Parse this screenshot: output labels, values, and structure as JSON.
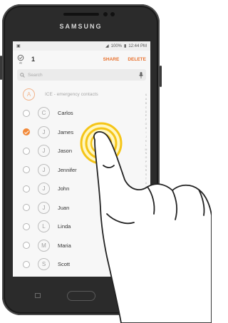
{
  "device": {
    "brand": "SAMSUNG"
  },
  "status_bar": {
    "battery": "100%",
    "time": "12:44 PM"
  },
  "action_bar": {
    "selected_count": "1",
    "share_label": "SHARE",
    "delete_label": "DELETE"
  },
  "search": {
    "placeholder": "Search"
  },
  "ice": {
    "letter": "A",
    "label": "ICE - emergency contacts"
  },
  "contacts": [
    {
      "initial": "C",
      "name": "Carlos",
      "checked": false
    },
    {
      "initial": "J",
      "name": "James",
      "checked": true
    },
    {
      "initial": "J",
      "name": "Jason",
      "checked": false
    },
    {
      "initial": "J",
      "name": "Jennifer",
      "checked": false
    },
    {
      "initial": "J",
      "name": "John",
      "checked": false
    },
    {
      "initial": "J",
      "name": "Juan",
      "checked": false
    },
    {
      "initial": "L",
      "name": "Linda",
      "checked": false
    },
    {
      "initial": "M",
      "name": "Maria",
      "checked": false
    },
    {
      "initial": "S",
      "name": "Scott",
      "checked": false
    }
  ],
  "index_letters": [
    "&",
    "A",
    "B",
    "C",
    "D",
    "E",
    "F",
    "G",
    "H",
    "I",
    "J",
    "K",
    "L",
    "M",
    "N",
    "O",
    "P",
    "Q",
    "R",
    "S",
    "T",
    "U",
    "V",
    "W",
    "X",
    "Y",
    "Z"
  ],
  "colors": {
    "accent": "#e8712d",
    "touch_ring": "#f5c518"
  }
}
